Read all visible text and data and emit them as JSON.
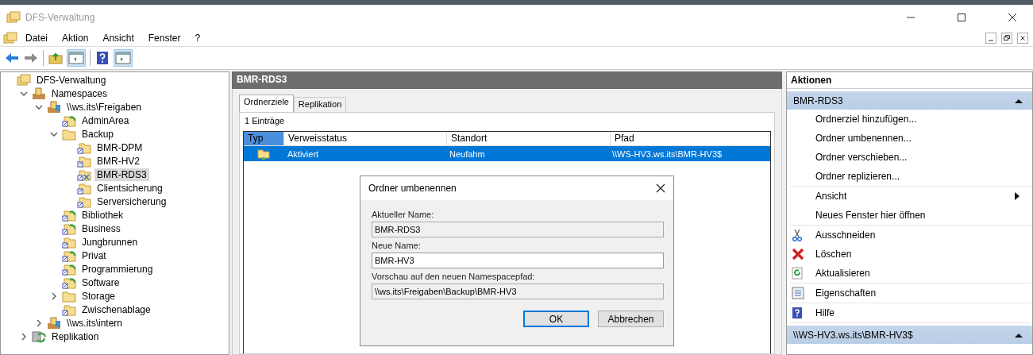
{
  "window": {
    "title": "DFS-Verwaltung"
  },
  "menu": [
    "Datei",
    "Aktion",
    "Ansicht",
    "Fenster",
    "?"
  ],
  "tree": [
    {
      "label": "DFS-Verwaltung",
      "kind": "console",
      "selected": false,
      "children": [
        {
          "label": "Namespaces",
          "kind": "namespaces",
          "expanded": true,
          "selected": false,
          "children": [
            {
              "label": "\\\\ws.its\\Freigaben",
              "kind": "namespace",
              "expanded": true,
              "selected": false,
              "children": [
                {
                  "label": "AdminArea",
                  "kind": "replicated",
                  "selected": false
                },
                {
                  "label": "Backup",
                  "kind": "folder",
                  "expanded": true,
                  "selected": false,
                  "children": [
                    {
                      "label": "BMR-DPM",
                      "kind": "link",
                      "selected": false
                    },
                    {
                      "label": "BMR-HV2",
                      "kind": "link",
                      "selected": false
                    },
                    {
                      "label": "BMR-RDS3",
                      "kind": "link-disabled",
                      "selected": true
                    },
                    {
                      "label": "Clientsicherung",
                      "kind": "link",
                      "selected": false
                    },
                    {
                      "label": "Serversicherung",
                      "kind": "link",
                      "selected": false
                    }
                  ]
                },
                {
                  "label": "Bibliothek",
                  "kind": "replicated",
                  "selected": false
                },
                {
                  "label": "Business",
                  "kind": "replicated",
                  "selected": false
                },
                {
                  "label": "Jungbrunnen",
                  "kind": "link",
                  "selected": false
                },
                {
                  "label": "Privat",
                  "kind": "replicated",
                  "selected": false
                },
                {
                  "label": "Programmierung",
                  "kind": "replicated",
                  "selected": false
                },
                {
                  "label": "Software",
                  "kind": "replicated",
                  "selected": false
                },
                {
                  "label": "Storage",
                  "kind": "folder",
                  "expanded": false,
                  "selected": false
                },
                {
                  "label": "Zwischenablage",
                  "kind": "link",
                  "selected": false
                }
              ]
            },
            {
              "label": "\\\\ws.its\\intern",
              "kind": "namespace",
              "expanded": false,
              "selected": false
            }
          ]
        },
        {
          "label": "Replikation",
          "kind": "replication",
          "expanded": false,
          "selected": false
        }
      ]
    }
  ],
  "center": {
    "title": "BMR-RDS3",
    "tabs": [
      {
        "label": "Ordnerziele",
        "selected": true
      },
      {
        "label": "Replikation",
        "selected": false
      }
    ],
    "count": "1 Einträge",
    "table": {
      "columns": [
        {
          "label": "Typ",
          "selected": true
        },
        {
          "label": "Verweisstatus",
          "selected": false
        },
        {
          "label": "Standort",
          "selected": false
        },
        {
          "label": "Pfad",
          "selected": false
        }
      ],
      "rows": [
        {
          "selected": true,
          "cells": [
            "",
            "Aktiviert",
            "Neufahm",
            "\\\\WS-HV3.ws.its\\BMR-HV3$"
          ]
        }
      ]
    }
  },
  "dialog": {
    "title": "Ordner umbenennen",
    "fields": [
      {
        "label": "Aktueller Name:",
        "value": "BMR-RDS3",
        "disabled": true
      },
      {
        "label": "Neue Name:",
        "value": "BMR-HV3",
        "disabled": false
      },
      {
        "label": "Vorschau auf den neuen Namespacepfad:",
        "value": "\\\\ws.its\\Freigaben\\Backup\\BMR-HV3",
        "disabled": true
      }
    ],
    "buttons": [
      {
        "label": "OK",
        "default": true
      },
      {
        "label": "Abbrechen",
        "default": false
      }
    ]
  },
  "actions": {
    "title": "Aktionen",
    "sections": [
      {
        "title": "BMR-RDS3",
        "groups": [
          [
            {
              "label": "Ordnerziel hinzufügen..."
            },
            {
              "label": "Ordner umbenennen..."
            },
            {
              "label": "Ordner verschieben..."
            },
            {
              "label": "Ordner replizieren..."
            }
          ],
          [
            {
              "label": "Ansicht",
              "submenu": true
            },
            {
              "label": "Neues Fenster hier öffnen"
            }
          ],
          [
            {
              "label": "Ausschneiden",
              "kind": "cut"
            },
            {
              "label": "Löschen",
              "kind": "delete"
            },
            {
              "label": "Aktualisieren",
              "kind": "refresh"
            }
          ],
          [
            {
              "label": "Eigenschaften",
              "kind": "properties"
            }
          ],
          [
            {
              "label": "Hilfe",
              "kind": "help"
            }
          ]
        ]
      },
      {
        "title": "\\\\WS-HV3.ws.its\\BMR-HV3$"
      }
    ]
  }
}
